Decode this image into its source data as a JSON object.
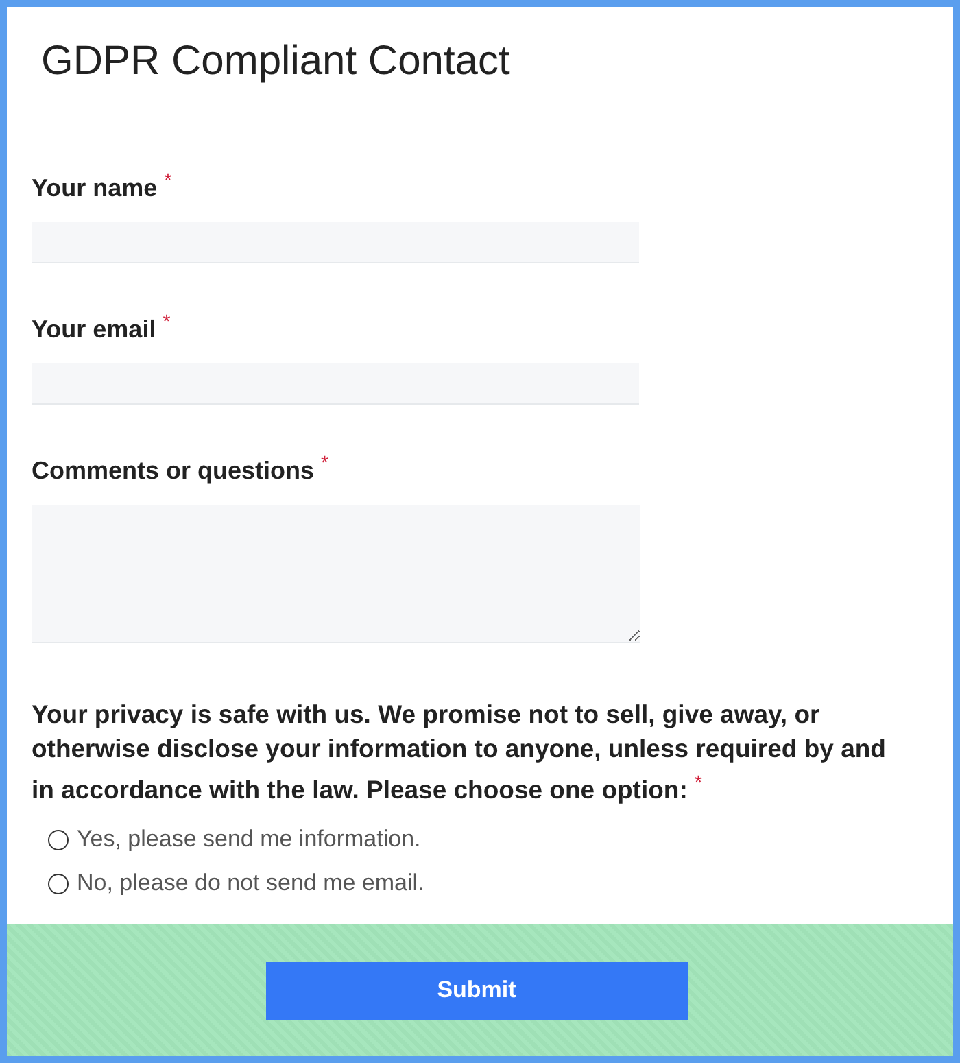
{
  "title": "GDPR Compliant Contact",
  "fields": [
    {
      "kind": "input",
      "label": "Your name $^{*}$"
    },
    {
      "kind": "input",
      "label": "Your email $^{*}$"
    },
    {
      "kind": "textarea",
      "label": "Comments or questions $^{*}$"
    }
  ],
  "consent": {
    "text": "Your privacy is safe with us. We promise not to sell, give away, or otherwise disclose your information to anyone, unless required by and in accordance with the law. Please choose one option: $^{*}$",
    "options": [
      {
        "label": "Yes, please send me information.",
        "selected": false
      },
      {
        "label": "No, please do not send me email.",
        "selected": false
      }
    ]
  },
  "submit": "Submit"
}
